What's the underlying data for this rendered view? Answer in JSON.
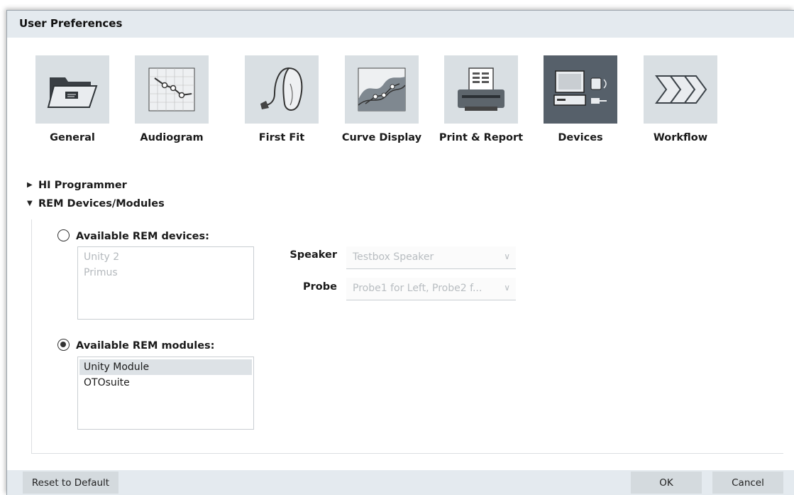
{
  "window": {
    "title": "User Preferences"
  },
  "categories": [
    {
      "label": "General",
      "icon": "folder-icon",
      "selected": false
    },
    {
      "label": "Audiogram",
      "icon": "audiogram-chart-icon",
      "selected": false
    },
    {
      "label": "First Fit",
      "icon": "hearing-aid-icon",
      "selected": false
    },
    {
      "label": "Curve Display",
      "icon": "curve-chart-icon",
      "selected": false
    },
    {
      "label": "Print & Report",
      "icon": "printer-icon",
      "selected": false
    },
    {
      "label": "Devices",
      "icon": "computer-device-icon",
      "selected": true
    },
    {
      "label": "Workflow",
      "icon": "workflow-arrows-icon",
      "selected": false
    }
  ],
  "tree": {
    "hi_programmer": {
      "label": "HI Programmer",
      "expanded": false
    },
    "rem": {
      "label": "REM Devices/Modules",
      "expanded": true
    }
  },
  "rem_devices": {
    "label": "Available REM devices:",
    "selected": false,
    "items": [
      "Unity 2",
      "Primus"
    ],
    "speaker": {
      "label": "Speaker",
      "value": "Testbox Speaker"
    },
    "probe": {
      "label": "Probe",
      "value": "Probe1 for Left, Probe2 f..."
    }
  },
  "rem_modules": {
    "label": "Available REM modules:",
    "selected": true,
    "items": [
      "Unity Module",
      "OTOsuite"
    ],
    "selected_item": "Unity Module"
  },
  "footer": {
    "reset_label": "Reset to Default",
    "ok_label": "OK",
    "cancel_label": "Cancel"
  },
  "colors": {
    "titlebar_bg": "#e4eaef",
    "tile_bg": "#d9dfe3",
    "tile_selected_bg": "#56606a",
    "button_bg": "#d4dade"
  }
}
